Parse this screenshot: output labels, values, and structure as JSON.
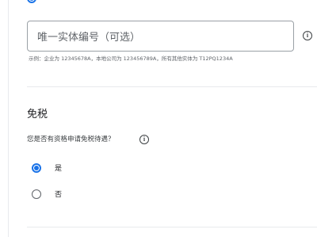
{
  "uen_field": {
    "placeholder": "唯一实体编号（可选）",
    "helper_text": "示例：企业为 12345678A，本地公司为 123456789A，所有其他实体为 T12PQ1234A"
  },
  "tax_exemption": {
    "title": "免税",
    "question": "您是否有资格申请免税待遇？",
    "options": [
      {
        "label": "是",
        "selected": true
      },
      {
        "label": "否",
        "selected": false
      }
    ]
  },
  "colors": {
    "accent": "#1a73e8",
    "border": "#9aa0a6",
    "divider": "#e8eaed",
    "text_secondary": "#5f6368"
  },
  "icons": {
    "info": "info-circle-icon"
  }
}
